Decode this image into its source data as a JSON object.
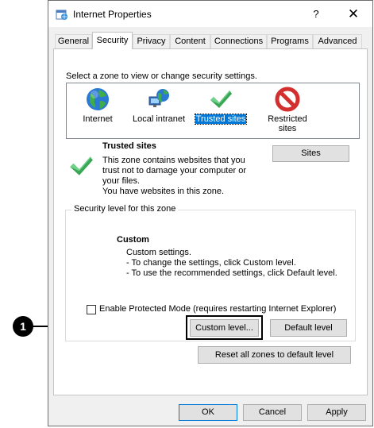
{
  "window": {
    "title": "Internet Properties",
    "help_glyph": "?",
    "close_glyph": "✕"
  },
  "tabs": [
    {
      "label": "General"
    },
    {
      "label": "Security"
    },
    {
      "label": "Privacy"
    },
    {
      "label": "Content"
    },
    {
      "label": "Connections"
    },
    {
      "label": "Programs"
    },
    {
      "label": "Advanced"
    }
  ],
  "active_tab": "Security",
  "security": {
    "instruction": "Select a zone to view or change security settings.",
    "zones": [
      {
        "label": "Internet",
        "icon": "globe-icon"
      },
      {
        "label": "Local intranet",
        "icon": "intranet-icon"
      },
      {
        "label": "Trusted sites",
        "icon": "checkmark-icon",
        "selected": true
      },
      {
        "label": "Restricted sites",
        "label_line1": "Restricted",
        "label_line2": "sites",
        "icon": "no-entry-icon"
      }
    ],
    "zone_info": {
      "title": "Trusted sites",
      "desc_lines": [
        "This zone contains websites that you",
        "trust not to damage your computer or",
        "your files.",
        "You have websites in this zone."
      ],
      "sites_button": "Sites"
    },
    "level_group": {
      "label": "Security level for this zone",
      "level_name": "Custom",
      "desc_lines": [
        "Custom settings.",
        "- To change the settings, click Custom level.",
        "- To use the recommended settings, click Default level."
      ],
      "protected_mode_label": "Enable Protected Mode (requires restarting Internet Explorer)",
      "protected_mode_checked": false,
      "custom_level_button": "Custom level...",
      "default_level_button": "Default level"
    },
    "reset_button": "Reset all zones to default level"
  },
  "footer": {
    "ok": "OK",
    "cancel": "Cancel",
    "apply": "Apply"
  },
  "callout": {
    "number": "1"
  },
  "colors": {
    "selection": "#0078d7",
    "check_green": "#3aa655",
    "restricted_red": "#d32f2f"
  }
}
